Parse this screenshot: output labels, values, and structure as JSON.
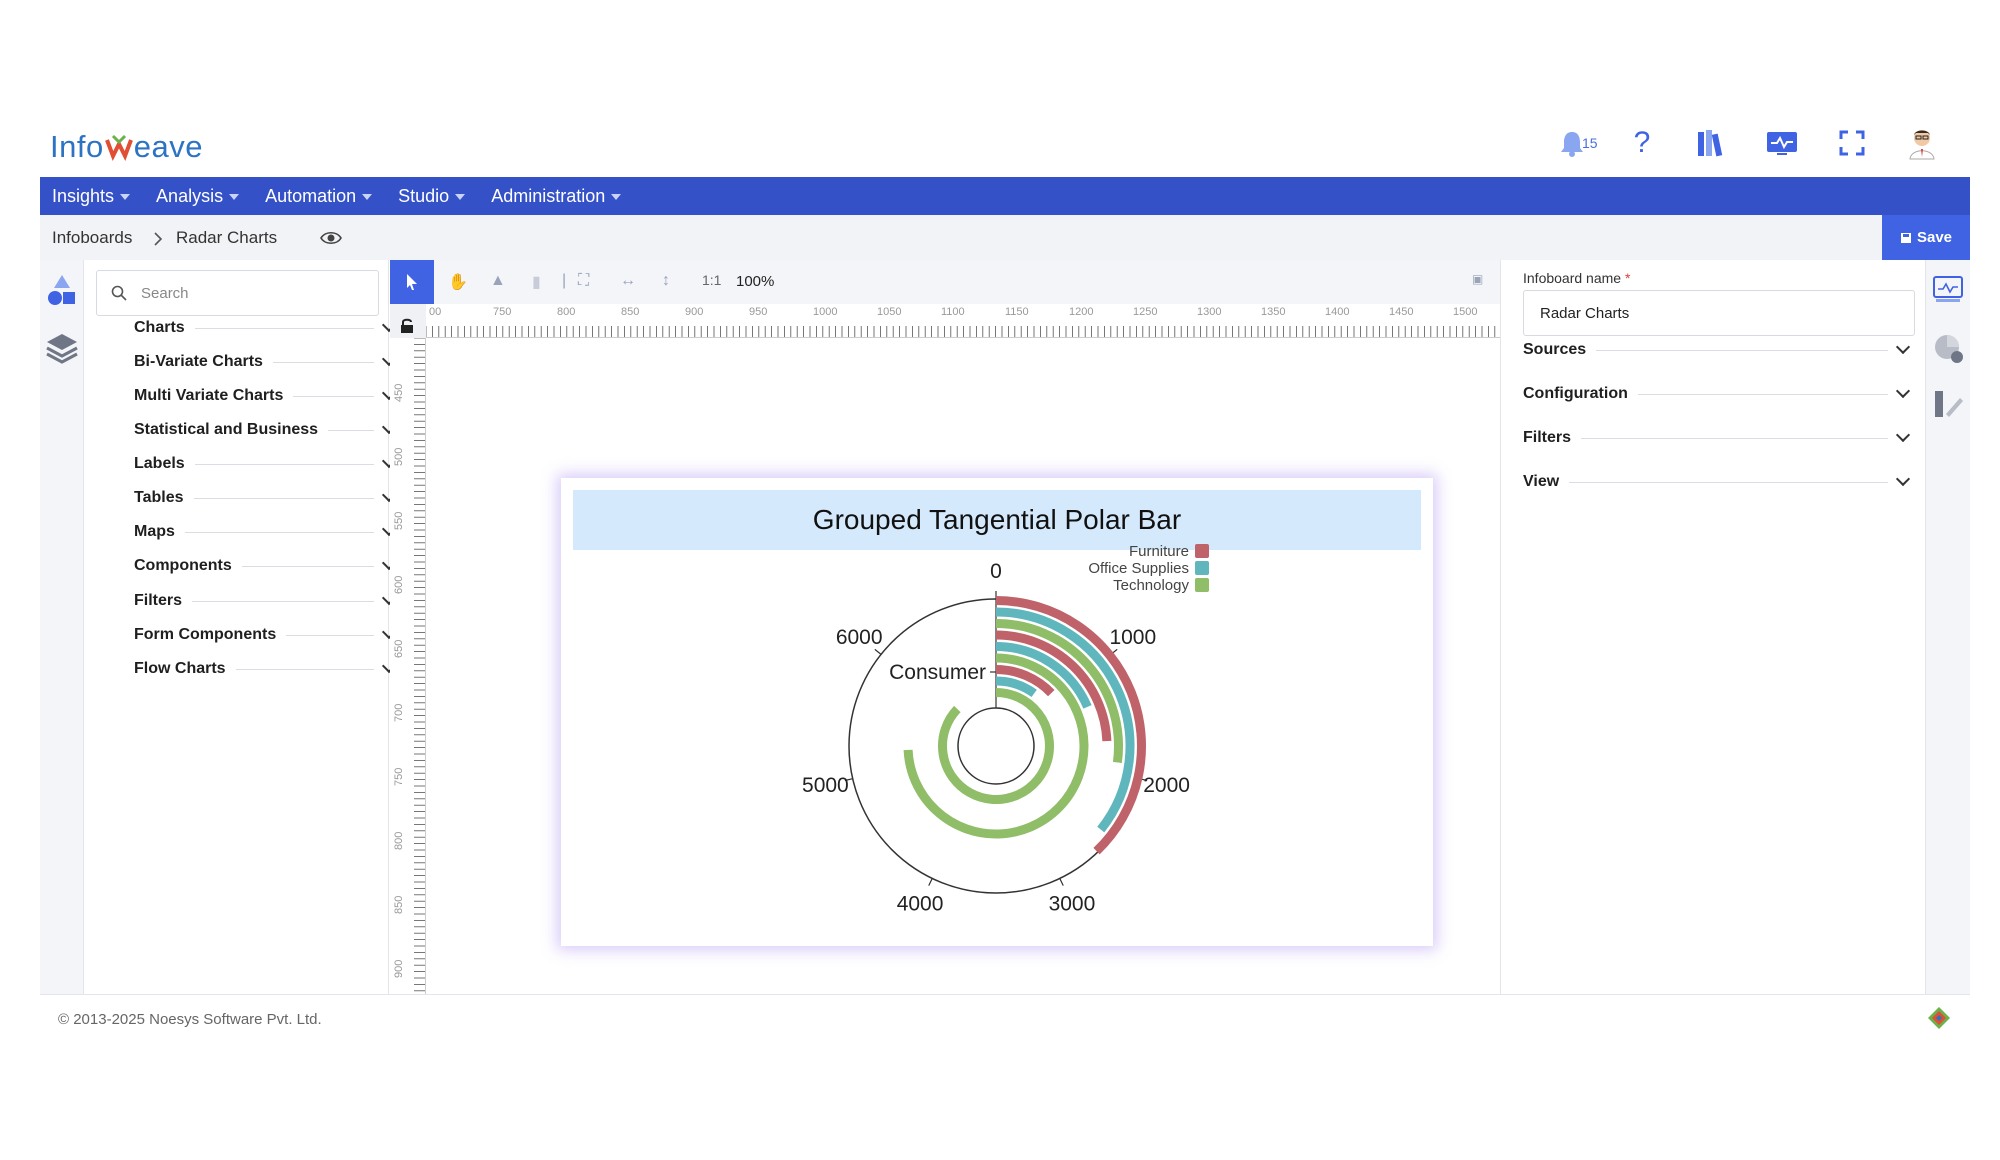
{
  "header": {
    "logo_left": "Info",
    "logo_right": "eave",
    "notification_count": "15"
  },
  "nav": {
    "items": [
      {
        "label": "Insights"
      },
      {
        "label": "Analysis"
      },
      {
        "label": "Automation"
      },
      {
        "label": "Studio"
      },
      {
        "label": "Administration"
      }
    ]
  },
  "breadcrumb": {
    "root": "Infoboards",
    "current": "Radar Charts"
  },
  "toolbar": {
    "save_label": "Save",
    "zoom": "100%",
    "ratio": "1:1"
  },
  "left_panel": {
    "search_placeholder": "Search",
    "sections": [
      {
        "label": "Charts"
      },
      {
        "label": "Bi-Variate Charts"
      },
      {
        "label": "Multi Variate Charts"
      },
      {
        "label": "Statistical and Business"
      },
      {
        "label": "Labels"
      },
      {
        "label": "Tables"
      },
      {
        "label": "Maps"
      },
      {
        "label": "Components"
      },
      {
        "label": "Filters"
      },
      {
        "label": "Form Components"
      },
      {
        "label": "Flow Charts"
      }
    ]
  },
  "rulers": {
    "h_ticks": [
      "00",
      "750",
      "800",
      "850",
      "900",
      "950",
      "1000",
      "1050",
      "1100",
      "1150",
      "1200",
      "1250",
      "1300",
      "1350",
      "1400",
      "1450",
      "1500"
    ],
    "v_ticks": [
      "450",
      "500",
      "550",
      "600",
      "650",
      "700",
      "750",
      "800",
      "850",
      "900"
    ]
  },
  "right_panel": {
    "name_label": "Infoboard name",
    "required_mark": "*",
    "name_value": "Radar Charts",
    "sections": [
      {
        "label": "Sources"
      },
      {
        "label": "Configuration"
      },
      {
        "label": "Filters"
      },
      {
        "label": "View"
      }
    ]
  },
  "footer": {
    "copyright": "© 2013-2025 Noesys Software Pvt. Ltd."
  },
  "colors": {
    "nav_bg": "#3451c8",
    "accent": "#3f63e3",
    "furniture": "#c0626a",
    "office_supplies": "#5fb7bd",
    "technology": "#8fbd68"
  },
  "chart_data": {
    "type": "polar_bar",
    "title": "Grouped Tangential Polar Bar",
    "categories": [
      "Consumer"
    ],
    "angular_ticks": [
      "0",
      "1000",
      "2000",
      "3000",
      "4000",
      "5000",
      "6000"
    ],
    "angular_range": [
      0,
      7000
    ],
    "legend_position": "top-right",
    "series": [
      {
        "name": "Furniture",
        "color": "#c0626a",
        "values": [
          2650,
          1700,
          900
        ]
      },
      {
        "name": "Office Supplies",
        "color": "#5fb7bd",
        "values": [
          2500,
          1300,
          700
        ]
      },
      {
        "name": "Technology",
        "color": "#8fbd68",
        "values": [
          1900,
          5200,
          6100
        ]
      }
    ]
  }
}
